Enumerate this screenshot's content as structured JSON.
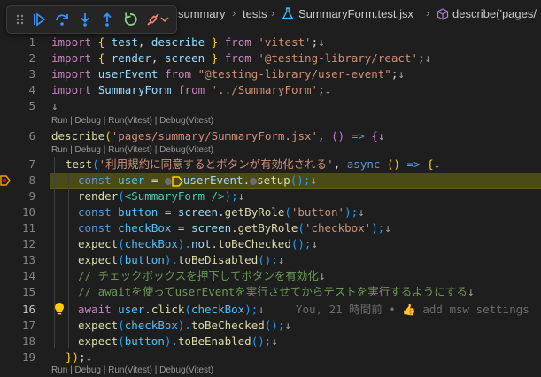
{
  "debug_toolbar": {
    "items": [
      "drag-handle",
      "continue",
      "step-over",
      "step-into",
      "step-out",
      "restart",
      "disconnect"
    ]
  },
  "breadcrumb": {
    "items": [
      "summary",
      "tests",
      "SummaryForm.test.jsx",
      "describe('pages/"
    ]
  },
  "codelens": {
    "text": "Run | Debug | Run(Vitest) | Debug(Vitest)"
  },
  "gutter": {
    "lines": [
      "1",
      "2",
      "3",
      "4",
      "5",
      "6",
      "7",
      "8",
      "9",
      "10",
      "11",
      "12",
      "13",
      "14",
      "15",
      "16",
      "17",
      "18",
      "19"
    ],
    "active_line": "16",
    "breakpoint_line": "8"
  },
  "code": {
    "l1": [
      "import",
      "{",
      "test",
      ",",
      "describe",
      "}",
      "from",
      "'vitest'",
      ";"
    ],
    "l2": [
      "import",
      "{",
      "render",
      ",",
      "screen",
      "}",
      "from",
      "'@testing-library/react'",
      ";"
    ],
    "l3": [
      "import",
      "userEvent",
      "from",
      "\"@testing-library/user-event\"",
      ";"
    ],
    "l4": [
      "import",
      "SummaryForm",
      "from",
      "'../SummaryForm'",
      ";"
    ],
    "l6": [
      "describe",
      "(",
      "'pages/summary/SummaryForm.jsx'",
      ",",
      "(",
      ")",
      "=>",
      "{"
    ],
    "l7": [
      "test",
      "(",
      "'利用規約に同意するとボタンが有効化される'",
      ",",
      "async",
      "(",
      ")",
      "=>",
      "{"
    ],
    "l8": [
      "const",
      "user",
      "=",
      "userEvent",
      ".",
      "setup",
      "();"
    ],
    "l9": [
      "render",
      "(",
      "<SummaryForm />",
      ");"
    ],
    "l10": [
      "const",
      "button",
      "=",
      "screen",
      ".",
      "getByRole",
      "(",
      "'button'",
      ");"
    ],
    "l11": [
      "const",
      "checkBox",
      "=",
      "screen",
      ".",
      "getByRole",
      "(",
      "'checkbox'",
      ");"
    ],
    "l12": [
      "expect",
      "(",
      "checkBox",
      ").",
      "not",
      ".",
      "toBeChecked",
      "();"
    ],
    "l13": [
      "expect",
      "(",
      "button",
      ").",
      "toBeDisabled",
      "();"
    ],
    "l14": "// チェックボックスを押下してボタンを有効化",
    "l15": "// awaitを使ってuserEventを実行させてからテストを実行するようにする",
    "l16": [
      "await",
      "user",
      ".",
      "click",
      "(",
      "checkBox",
      ");"
    ],
    "l17": [
      "expect",
      "(",
      "checkBox",
      ").",
      "toBeChecked",
      "();"
    ],
    "l18": [
      "expect",
      "(",
      "button",
      ").",
      "toBeEnabled",
      "();"
    ],
    "l19": [
      "})",
      ";"
    ],
    "eol": "↓"
  },
  "blame": {
    "text": "You, 21 時間前 • 👍 add msw settings"
  },
  "colors": {
    "background": "#1e1e1e",
    "keyword": "#c586c0",
    "string": "#ce9178",
    "function": "#dcdcaa",
    "variable": "#9cdcfe",
    "comment": "#6a9955",
    "breakpoint": "#e5a000",
    "debug_blue": "#3794ff",
    "debug_green": "#89d185",
    "debug_red": "#f48771"
  }
}
